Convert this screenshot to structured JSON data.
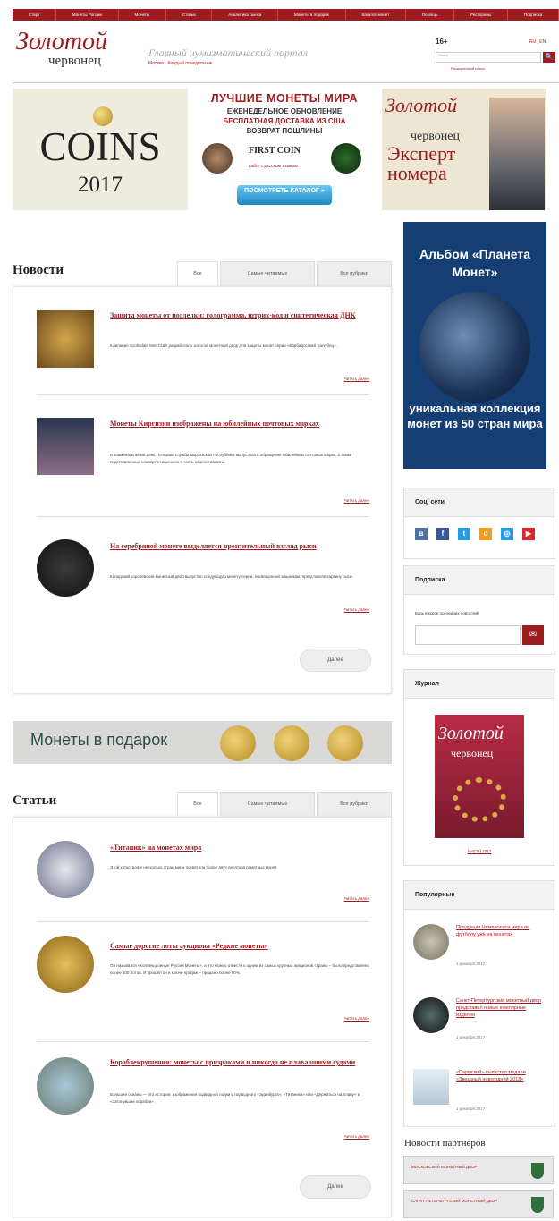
{
  "nav": {
    "items": [
      "Старт",
      "Монеты России",
      "Монеты",
      "Статьи",
      "Аналитика рынка",
      "Монеты в подарок",
      "Каталог монет",
      "Помощь",
      "Рестораны",
      "Подписка"
    ]
  },
  "header": {
    "logo_top": "Золотой",
    "logo_bottom": "червонец",
    "tagline": "Главный нумизматический портал",
    "subline": "Москва · Каждый понедельник",
    "age": "16+",
    "langs": "RU | EN",
    "search_placeholder": "Поиск",
    "search_btn": "🔍",
    "advanced": "Расширенный поиск"
  },
  "banners": {
    "coins": {
      "title": "COINS",
      "year": "2017"
    },
    "firstcoin": {
      "l1": "ЛУЧШИЕ МОНЕТЫ МИРА",
      "l2": "ЕЖЕНЕДЕЛЬНОЕ ОБНОВЛЕНИЕ",
      "l3": "БЕСПЛАТНАЯ ДОСТАВКА ИЗ США",
      "l4": "ВОЗВРАТ ПОШЛИНЫ",
      "brand": "FIRST COIN",
      "site": "сайт с русским языком",
      "btn": "ПОСМОТРЕТЬ КАТАЛОГ »"
    },
    "expert": {
      "logo_top": "Золотой",
      "logo_bottom": "червонец",
      "text": "Эксперт номера"
    }
  },
  "news": {
    "title": "Новости",
    "tabs": [
      "Все",
      "Самые читаемые",
      "Все рубрики"
    ],
    "items": [
      {
        "title": "Защита монеты от подделки: голограмма, штрих-код и синтетическая ДНК",
        "text": "Компания Scottsdale Mint США разработала золотой монетный двор для защиты монет серии «Барбадосский трезубец».",
        "more": "Читать далее"
      },
      {
        "title": "Монеты Киргизии изображены на юбилейных почтовых марках",
        "text": "В знаменательный день Почтовая служба Кыргызской Республики выпустила в обращение юбилейные почтовые марки, а также подготовленный конверт с гашением в честь юбилея валюты.",
        "more": "Читать далее"
      },
      {
        "title": "На серебряной монете выделяется пронзительный взгляд рыси",
        "text": "Канадский королевский монетный двор выпустил следующую монету серии, посвященной хищникам, представляя картину рыси.",
        "more": "Читать далее"
      }
    ],
    "more_btn": "Далее"
  },
  "gift": {
    "text": "Монеты в подарок"
  },
  "articles": {
    "title": "Статьи",
    "tabs": [
      "Все",
      "Самые читаемые",
      "Все рубрики"
    ],
    "items": [
      {
        "title": "«Титаник» на монетах мира",
        "text": "Этой катастрофе несколько стран мира посвятили более двух десятков памятных монет.",
        "more": "Читать далее"
      },
      {
        "title": "Самые дорогие лоты аукциона «Редкие монеты»",
        "text": "Он назывался «Коллекционные России Монеты», и это можно отнести к одним из самых крупных аукционов страны – было представлено более 500 лотов. И прошел он в ключе продаж – продано более 60%.",
        "more": "Читать далее"
      },
      {
        "title": "Кораблекрушения: монеты с призраками и никогда не плававшими судами",
        "text": "Большие океаны — это история, изображения подводной лодки и подводного «Эдинбурга», «Титаника» или «Держаться на плаву» и «Затонувшие корабли».",
        "more": "Читать далее"
      }
    ],
    "more_btn": "Далее"
  },
  "sidebar": {
    "album": {
      "l1": "Альбом «Планета Монет»",
      "l2": "уникальная коллекция монет из 50 стран мира"
    },
    "social": {
      "title": "Соц. сети",
      "icons": [
        "vk-icon",
        "facebook-icon",
        "twitter-icon",
        "odnoklassniki-icon",
        "livejournal-icon",
        "youtube-icon"
      ]
    },
    "subscribe": {
      "title": "Подписка",
      "label": "Будь в курсе последних новостей!",
      "btn": "✉"
    },
    "magazine": {
      "title": "Журнал",
      "cover_top": "Золотой",
      "cover_bottom": "червонец",
      "issue": "№4(38) 2017"
    },
    "popular": {
      "title": "Популярные",
      "items": [
        {
          "title": "Продукция Чемпионата мира по футболу уже на монетах",
          "date": "1 декабря 2017"
        },
        {
          "title": "Санкт-Петербургский монетный двор представил новые ювелирные изделия",
          "date": "1 декабря 2017"
        },
        {
          "title": "«Пармский» выпустил медали «Звездный новогодний 2018»",
          "date": "1 декабря 2017"
        }
      ]
    },
    "partners": {
      "title": "Новости партнеров",
      "items": [
        "МОСКОВСКИЙ МОНЕТНЫЙ ДВОР",
        "САНКТ-ПЕТЕРБУРГСКИЙ МОНЕТНЫЙ ДВОР"
      ]
    }
  },
  "colors": {
    "brand": "#9c1c1f",
    "album": "#143e74"
  }
}
